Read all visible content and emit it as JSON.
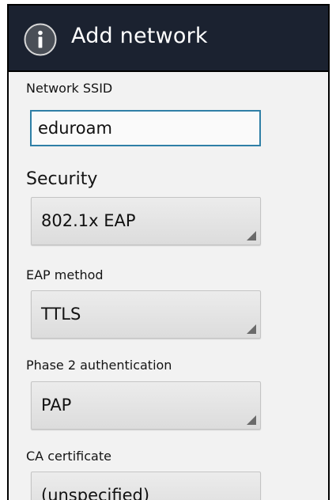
{
  "dialog": {
    "title": "Add network",
    "icon": "info-icon"
  },
  "ssid": {
    "label": "Network SSID",
    "value": "eduroam"
  },
  "security": {
    "label": "Security",
    "value": "802.1x EAP"
  },
  "eap_method": {
    "label": "EAP method",
    "value": "TTLS"
  },
  "phase2": {
    "label": "Phase 2 authentication",
    "value": "PAP"
  },
  "ca_certificate": {
    "label": "CA certificate",
    "value": "(unspecified)"
  },
  "colors": {
    "titlebar": "#1b2230",
    "input_focus_border": "#2f7fa6",
    "background": "#f2f2f2"
  }
}
